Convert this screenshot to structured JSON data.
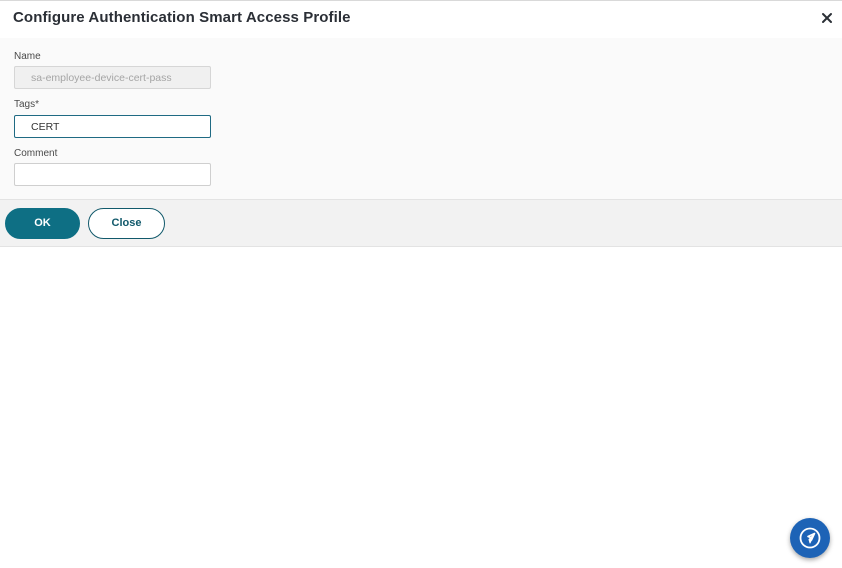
{
  "dialog": {
    "title": "Configure Authentication Smart Access Profile",
    "close_icon": "close-icon"
  },
  "form": {
    "name": {
      "label": "Name",
      "value": "sa-employee-device-cert-pass",
      "disabled": true
    },
    "tags": {
      "label": "Tags*",
      "value": "CERT"
    },
    "comment": {
      "label": "Comment",
      "value": ""
    }
  },
  "actions": {
    "ok_label": "OK",
    "close_label": "Close"
  },
  "floating_button": {
    "icon": "navigation-icon"
  },
  "colors": {
    "primary": "#0e6f84",
    "fab": "#1d63b6",
    "title": "#2b2f36"
  }
}
